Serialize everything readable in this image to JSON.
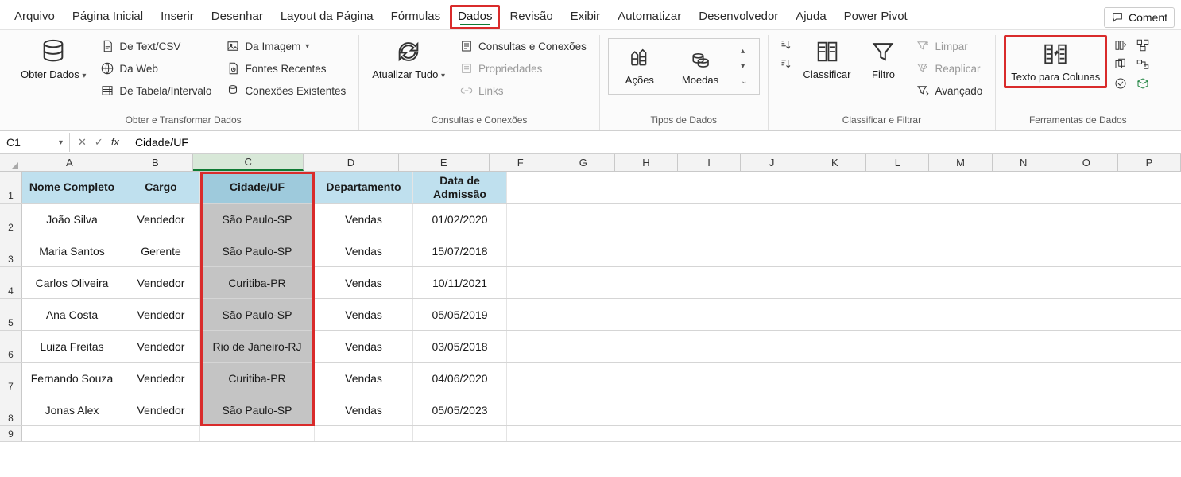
{
  "tabs": {
    "arquivo": "Arquivo",
    "pagina_inicial": "Página Inicial",
    "inserir": "Inserir",
    "desenhar": "Desenhar",
    "layout": "Layout da Página",
    "formulas": "Fórmulas",
    "dados": "Dados",
    "revisao": "Revisão",
    "exibir": "Exibir",
    "automatizar": "Automatizar",
    "desenvolvedor": "Desenvolvedor",
    "ajuda": "Ajuda",
    "power_pivot": "Power Pivot",
    "comentarios": "Coment"
  },
  "ribbon": {
    "obter_dados": "Obter Dados",
    "de_text_csv": "De Text/CSV",
    "da_imagem": "Da Imagem",
    "da_web": "Da Web",
    "fontes_recentes": "Fontes Recentes",
    "de_tabela": "De Tabela/Intervalo",
    "conexoes_exist": "Conexões Existentes",
    "group_obter": "Obter e Transformar Dados",
    "atualizar_tudo": "Atualizar Tudo",
    "consultas_conexoes": "Consultas e Conexões",
    "propriedades": "Propriedades",
    "links": "Links",
    "group_consultas": "Consultas e Conexões",
    "acoes": "Ações",
    "moedas": "Moedas",
    "group_tipos": "Tipos de Dados",
    "classificar": "Classificar",
    "filtro": "Filtro",
    "limpar": "Limpar",
    "reaplicar": "Reaplicar",
    "avancado": "Avançado",
    "group_filtro": "Classificar e Filtrar",
    "texto_colunas": "Texto para Colunas",
    "group_ferramentas": "Ferramentas de Dados"
  },
  "name_box": "C1",
  "formula_value": "Cidade/UF",
  "columns": [
    "A",
    "B",
    "C",
    "D",
    "E",
    "F",
    "G",
    "H",
    "I",
    "J",
    "K",
    "L",
    "M",
    "N",
    "O",
    "P"
  ],
  "headers": {
    "nome": "Nome Completo",
    "cargo": "Cargo",
    "cidade": "Cidade/UF",
    "departamento": "Departamento",
    "data": "Data de Admissão"
  },
  "rows": [
    {
      "nome": "João Silva",
      "cargo": "Vendedor",
      "cidade": "São Paulo-SP",
      "dep": "Vendas",
      "data": "01/02/2020"
    },
    {
      "nome": "Maria Santos",
      "cargo": "Gerente",
      "cidade": "São Paulo-SP",
      "dep": "Vendas",
      "data": "15/07/2018"
    },
    {
      "nome": "Carlos Oliveira",
      "cargo": "Vendedor",
      "cidade": "Curitiba-PR",
      "dep": "Vendas",
      "data": "10/11/2021"
    },
    {
      "nome": "Ana Costa",
      "cargo": "Vendedor",
      "cidade": "São Paulo-SP",
      "dep": "Vendas",
      "data": "05/05/2019"
    },
    {
      "nome": "Luiza Freitas",
      "cargo": "Vendedor",
      "cidade": "Rio de Janeiro-RJ",
      "dep": "Vendas",
      "data": "03/05/2018"
    },
    {
      "nome": "Fernando Souza",
      "cargo": "Vendedor",
      "cidade": "Curitiba-PR",
      "dep": "Vendas",
      "data": "04/06/2020"
    },
    {
      "nome": "Jonas Alex",
      "cargo": "Vendedor",
      "cidade": "São Paulo-SP",
      "dep": "Vendas",
      "data": "05/05/2023"
    }
  ]
}
